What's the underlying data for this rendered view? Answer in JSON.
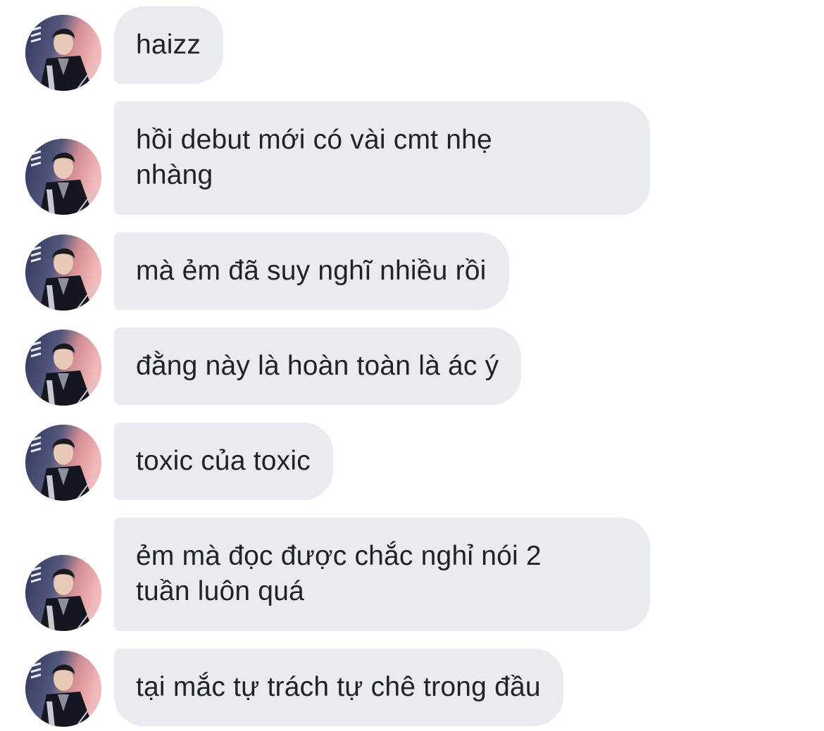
{
  "messages": [
    {
      "text": "haizz"
    },
    {
      "text": "hồi debut mới có vài cmt nhẹ\nnhàng"
    },
    {
      "text": "mà ẻm đã suy nghĩ nhiều rồi"
    },
    {
      "text": "đằng này là hoàn toàn là ác ý"
    },
    {
      "text": "toxic của toxic"
    },
    {
      "text": "ẻm mà đọc được chắc nghỉ nói 2\ntuần luôn quá"
    },
    {
      "text": "tại mắc tự trách tự chê trong đầu"
    }
  ],
  "colors": {
    "bubble_bg": "#e8ecf0",
    "text": "#1f2328",
    "background": "#ffffff"
  },
  "icons": {
    "avatar": "sender-avatar"
  }
}
